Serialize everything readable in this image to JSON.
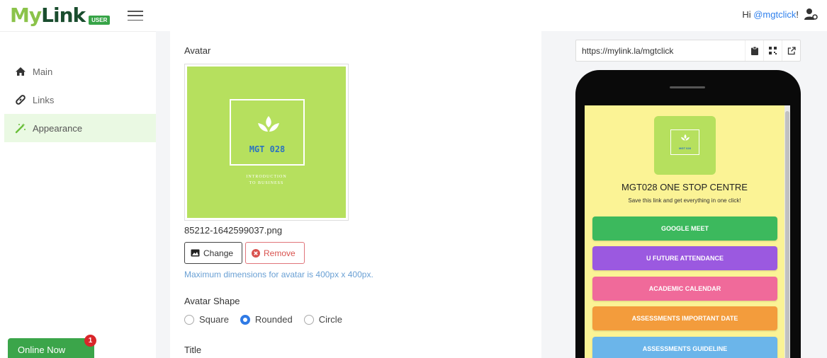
{
  "header": {
    "logo_my": "My",
    "logo_link": "Link",
    "logo_badge": "USER",
    "greeting_prefix": "Hi ",
    "username": "@mgtclick",
    "greeting_suffix": "!"
  },
  "sidebar": {
    "items": [
      {
        "label": "Main",
        "icon": "home-icon"
      },
      {
        "label": "Links",
        "icon": "link-icon"
      },
      {
        "label": "Appearance",
        "icon": "magic-wand-icon",
        "active": true
      }
    ]
  },
  "online": {
    "label": "Online Now",
    "count": "1"
  },
  "main": {
    "avatar_label": "Avatar",
    "avatar_code": "MGT 028",
    "avatar_sub": "INTRODUCTION\nTO BUSINESS",
    "filename": "85212-1642599037.png",
    "change_label": "Change",
    "remove_label": "Remove",
    "hint": "Maximum dimensions for avatar is 400px x 400px.",
    "shape_label": "Avatar Shape",
    "shapes": [
      {
        "label": "Square",
        "checked": false
      },
      {
        "label": "Rounded",
        "checked": true
      },
      {
        "label": "Circle",
        "checked": false
      }
    ],
    "title_label": "Title"
  },
  "preview": {
    "url": "https://mylink.la/mgtclick",
    "mini_code": "MGT 028",
    "title": "MGT028 ONE STOP CENTRE",
    "description": "Save this link and get everything in one click!",
    "links": [
      {
        "label": "GOOGLE MEET",
        "color": "#3cb95d"
      },
      {
        "label": "U FUTURE ATTENDANCE",
        "color": "#9b59e0"
      },
      {
        "label": "ACADEMIC CALENDAR",
        "color": "#f06a9a"
      },
      {
        "label": "ASSESSMENTS IMPORTANT DATE",
        "color": "#f39c3c"
      },
      {
        "label": "ASSESSMENTS GUIDELINE",
        "color": "#6bb5ea"
      }
    ]
  }
}
